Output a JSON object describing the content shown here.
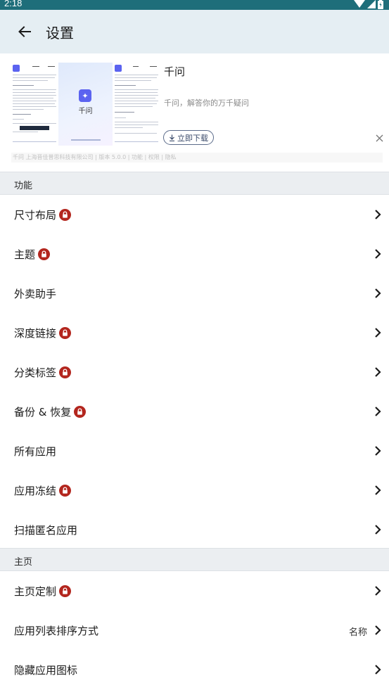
{
  "status_bar": {
    "time": "2:18"
  },
  "app_bar": {
    "title": "设置"
  },
  "ad": {
    "title": "千问",
    "description": "千问，解答你的万千疑问",
    "download_label": "立即下载",
    "screenshot_app_name": "千问",
    "screenshot_logo": "✦",
    "info_text": "千问 上海晋佳普思科技有限公司 | 版本 5.0.0 | 功能 | 权限 | 隐私"
  },
  "sections": [
    {
      "title": "功能",
      "items": [
        {
          "label": "尺寸布局",
          "locked": true
        },
        {
          "label": "主题",
          "locked": true
        },
        {
          "label": "外卖助手",
          "locked": false
        },
        {
          "label": "深度链接",
          "locked": true
        },
        {
          "label": "分类标签",
          "locked": true
        },
        {
          "label": "备份 & 恢复",
          "locked": true
        },
        {
          "label": "所有应用",
          "locked": false
        },
        {
          "label": "应用冻结",
          "locked": true
        },
        {
          "label": "扫描匿名应用",
          "locked": false
        }
      ]
    },
    {
      "title": "主页",
      "items": [
        {
          "label": "主页定制",
          "locked": true
        },
        {
          "label": "应用列表排序方式",
          "locked": false,
          "value": "名称"
        },
        {
          "label": "隐藏应用图标",
          "locked": false
        }
      ]
    }
  ],
  "colors": {
    "status_bar": "#1e6e7a",
    "app_bar": "#e5eef3",
    "lock_badge": "#b3261e",
    "section_header": "#ebeef1"
  },
  "icons": {
    "back": "arrow-left-icon",
    "lock": "lock-icon",
    "chevron": "chevron-right-icon",
    "close": "close-icon",
    "download": "download-icon"
  }
}
